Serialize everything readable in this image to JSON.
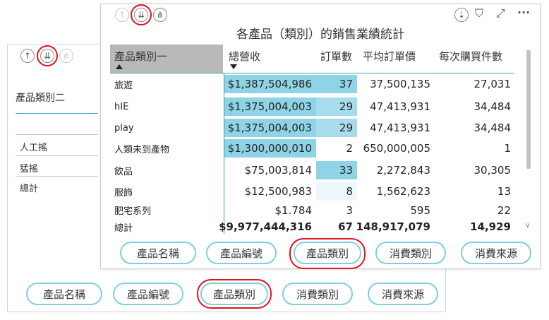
{
  "back": {
    "nav": {
      "up": "↑",
      "drill_all": "⇊",
      "expand": "⋔"
    },
    "slicer_title": "產品類別二",
    "slicer_items": [
      "人工搖",
      "猛搖",
      "總計"
    ],
    "buttons": [
      "產品名稱",
      "產品編號",
      "產品類別",
      "消費類別",
      "消費來源"
    ],
    "highlighted_button": "產品類別"
  },
  "front": {
    "nav": {
      "up": "↑",
      "drill_all": "⇊",
      "expand": "⋔"
    },
    "toolbar": {
      "drill_icon": "⇣",
      "filter_icon": "⛉",
      "focus_icon": "⤢",
      "more_icon": "···"
    },
    "title": "各產品（類別）的銷售業績統計",
    "columns": [
      "產品類別一",
      "總營收",
      "訂單數",
      "平均訂單價",
      "每次購買件數"
    ],
    "rows": [
      {
        "name": "旅遊",
        "revenue": "$1,387,504,986",
        "orders": "37",
        "avg": "37,500,135",
        "items": "27,031"
      },
      {
        "name": "hIE",
        "revenue": "$1,375,004,003",
        "orders": "29",
        "avg": "47,413,931",
        "items": "34,484"
      },
      {
        "name": "play",
        "revenue": "$1,375,004,003",
        "orders": "29",
        "avg": "47,413,931",
        "items": "34,484"
      },
      {
        "name": "人類未到產物",
        "revenue": "$1,300,000,010",
        "orders": "2",
        "avg": "650,000,005",
        "items": "1"
      },
      {
        "name": "飲品",
        "revenue": "$75,003,814",
        "orders": "33",
        "avg": "2,272,843",
        "items": "30,305"
      },
      {
        "name": "服飾",
        "revenue": "$12,500,983",
        "orders": "8",
        "avg": "1,562,623",
        "items": "13"
      },
      {
        "name": "肥宅系列",
        "revenue": "$1.784",
        "orders": "3",
        "avg": "595",
        "items": "22"
      }
    ],
    "total": {
      "name": "總計",
      "revenue": "$9,977,444,316",
      "orders": "67",
      "avg": "148,917,079",
      "items": "14,929"
    },
    "buttons": [
      "產品名稱",
      "產品編號",
      "產品類別",
      "消費類別",
      "消費來源"
    ],
    "highlighted_button": "產品類別"
  },
  "colors": {
    "accent": "#2ea7b8",
    "highlight_ring": "#e3111f",
    "pill_border": "#7fd0dc",
    "cond_dark": "#8fd3e6",
    "cond_mid": "#a6dcec",
    "cond_light": "#eef8fc"
  }
}
